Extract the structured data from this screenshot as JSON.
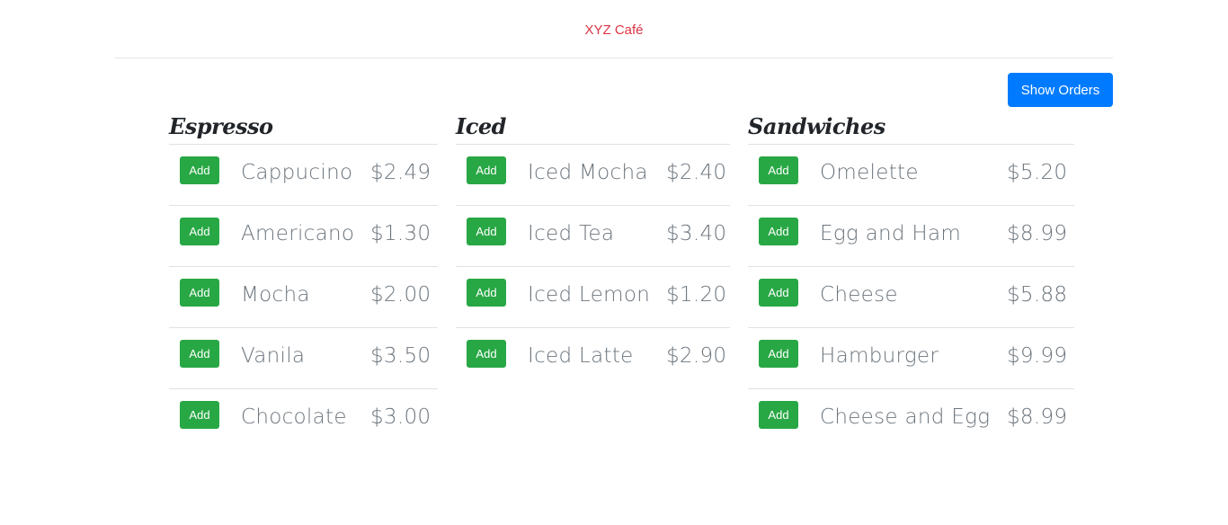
{
  "navbar": {
    "brand": "XYZ Café"
  },
  "actions": {
    "show_orders_label": "Show Orders"
  },
  "categories": {
    "espresso": {
      "title": "Espresso",
      "items": [
        {
          "name": "Cappucino",
          "price": "$2.49"
        },
        {
          "name": "Americano",
          "price": "$1.30"
        },
        {
          "name": "Mocha",
          "price": "$2.00"
        },
        {
          "name": "Vanila",
          "price": "$3.50"
        },
        {
          "name": "Chocolate",
          "price": "$3.00"
        }
      ]
    },
    "iced": {
      "title": "Iced",
      "items": [
        {
          "name": "Iced Mocha",
          "price": "$2.40"
        },
        {
          "name": "Iced Tea",
          "price": "$3.40"
        },
        {
          "name": "Iced Lemon",
          "price": "$1.20"
        },
        {
          "name": "Iced Latte",
          "price": "$2.90"
        }
      ]
    },
    "sandwiches": {
      "title": "Sandwiches",
      "items": [
        {
          "name": "Omelette",
          "price": "$5.20"
        },
        {
          "name": "Egg and Ham",
          "price": "$8.99"
        },
        {
          "name": "Cheese",
          "price": "$5.88"
        },
        {
          "name": "Hamburger",
          "price": "$9.99"
        },
        {
          "name": "Cheese and Egg",
          "price": "$8.99"
        }
      ]
    }
  },
  "add_label": "Add",
  "colors": {
    "brand": "#dc3545",
    "primary_button": "#007bff",
    "add_button": "#28a745",
    "item_text": "#6c757d"
  }
}
